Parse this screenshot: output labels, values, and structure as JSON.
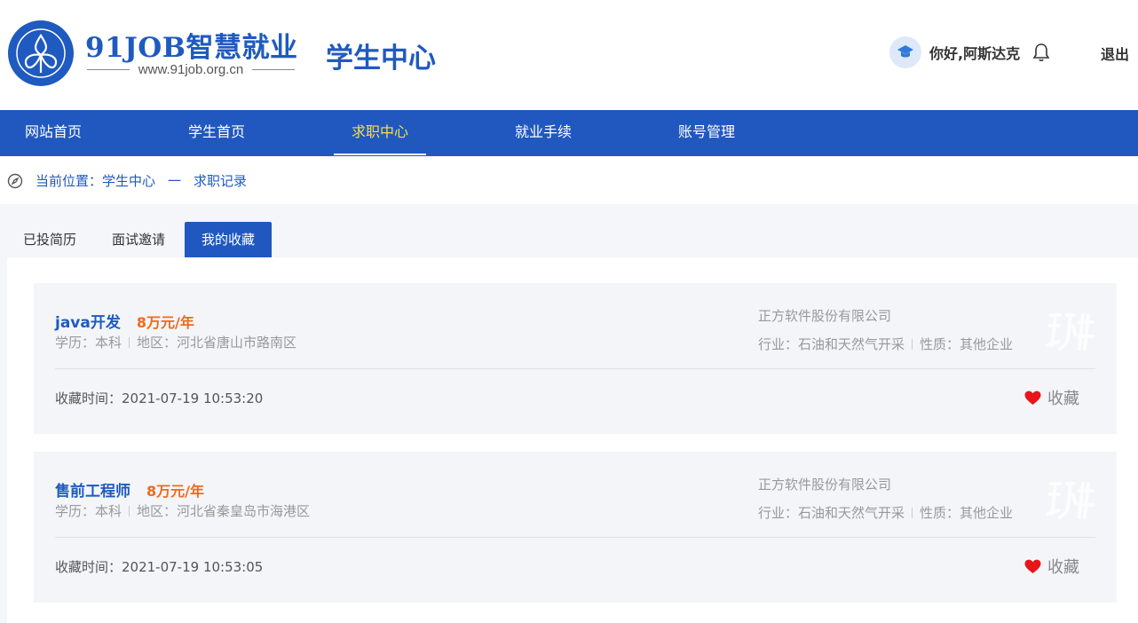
{
  "header": {
    "logo_title": "91JOB智慧就业",
    "logo_url": "www.91job.org.cn",
    "portal_title": "学生中心",
    "greeting": "你好,阿斯达克",
    "logout_label": "退出"
  },
  "nav": {
    "items": [
      {
        "label": "网站首页"
      },
      {
        "label": "学生首页"
      },
      {
        "label": "求职中心"
      },
      {
        "label": "就业手续"
      },
      {
        "label": "账号管理"
      }
    ],
    "active_index": 2
  },
  "breadcrumb": {
    "prefix": "当前位置：",
    "level1": "学生中心",
    "separator": "一",
    "level2": "求职记录"
  },
  "tabs": [
    {
      "label": "已投简历"
    },
    {
      "label": "面试邀请"
    },
    {
      "label": "我的收藏"
    }
  ],
  "favorites": [
    {
      "title": "java开发",
      "salary": "8万元/年",
      "education": "学历：本科",
      "region": "地区：河北省唐山市路南区",
      "company": "正方软件股份有限公司",
      "industry": "行业：石油和天然气开采",
      "nature": "性质：其他企业",
      "fav_time": "收藏时间：2021-07-19 10:53:20",
      "fav_label": "收藏"
    },
    {
      "title": "售前工程师",
      "salary": "8万元/年",
      "education": "学历：本科",
      "region": "地区：河北省秦皇岛市海港区",
      "company": "正方软件股份有限公司",
      "industry": "行业：石油和天然气开采",
      "nature": "性质：其他企业",
      "fav_time": "收藏时间：2021-07-19 10:53:05",
      "fav_label": "收藏"
    }
  ],
  "colors": {
    "brand_blue": "#2058bf",
    "nav_active_text": "#f5e14a",
    "salary_orange": "#f06a1a",
    "heart_red": "#e8151b"
  }
}
